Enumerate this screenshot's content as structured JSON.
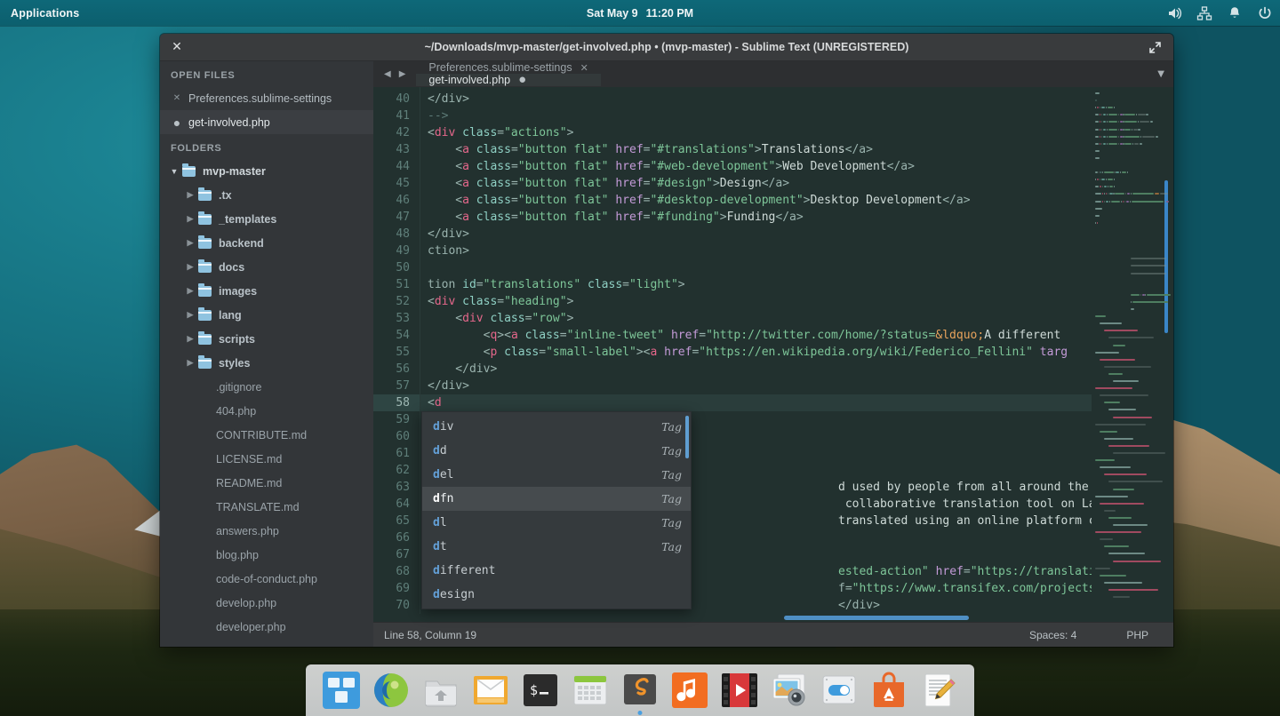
{
  "panel": {
    "applications_label": "Applications",
    "clock_day": "Sat May  9",
    "clock_time": "11:20 PM",
    "tray": [
      "volume-icon",
      "network-icon",
      "notification-icon",
      "power-icon"
    ]
  },
  "window": {
    "title": "~/Downloads/mvp-master/get-involved.php • (mvp-master) - Sublime Text (UNREGISTERED)",
    "close_glyph": "✕",
    "maximize_glyph": "⤢"
  },
  "sidebar": {
    "open_files_title": "OPEN FILES",
    "open_files": [
      {
        "name": "Preferences.sublime-settings",
        "icon": "close-icon",
        "active": false
      },
      {
        "name": "get-involved.php",
        "icon": "unsaved-dot-icon",
        "active": true
      }
    ],
    "folders_title": "FOLDERS",
    "root": "mvp-master",
    "folders": [
      ".tx",
      "_templates",
      "backend",
      "docs",
      "images",
      "lang",
      "scripts",
      "styles"
    ],
    "files": [
      ".gitignore",
      "404.php",
      "CONTRIBUTE.md",
      "LICENSE.md",
      "README.md",
      "TRANSLATE.md",
      "answers.php",
      "blog.php",
      "code-of-conduct.php",
      "develop.php",
      "developer.php"
    ]
  },
  "tabs": {
    "nav_prev": "◀",
    "nav_next": "▶",
    "menu_glyph": "▼",
    "items": [
      {
        "label": "Preferences.sublime-settings",
        "active": false,
        "badge": "✕"
      },
      {
        "label": "get-involved.php",
        "active": true,
        "badge": "●"
      }
    ]
  },
  "editor": {
    "first_line": 40,
    "current_line": 58,
    "lines": [
      {
        "n": 40,
        "tokens": [
          {
            "t": "</div>",
            "c": "c-punct"
          }
        ]
      },
      {
        "n": 41,
        "tokens": [
          {
            "t": "-->",
            "c": "c-comm"
          }
        ]
      },
      {
        "n": 42,
        "tokens": [
          {
            "t": "<",
            "c": "c-punct"
          },
          {
            "t": "div",
            "c": "c-tag"
          },
          {
            "t": " ",
            "c": "c-text"
          },
          {
            "t": "class",
            "c": "c-op"
          },
          {
            "t": "=",
            "c": "c-punct"
          },
          {
            "t": "\"actions\"",
            "c": "c-str"
          },
          {
            "t": ">",
            "c": "c-punct"
          }
        ]
      },
      {
        "n": 43,
        "tokens": [
          {
            "t": "    <",
            "c": "c-punct"
          },
          {
            "t": "a",
            "c": "c-tag"
          },
          {
            "t": " ",
            "c": "c-text"
          },
          {
            "t": "class",
            "c": "c-op"
          },
          {
            "t": "=",
            "c": "c-punct"
          },
          {
            "t": "\"button flat\"",
            "c": "c-str"
          },
          {
            "t": " ",
            "c": "c-text"
          },
          {
            "t": "href",
            "c": "c-attr"
          },
          {
            "t": "=",
            "c": "c-punct"
          },
          {
            "t": "\"#translations\"",
            "c": "c-str"
          },
          {
            "t": ">",
            "c": "c-punct"
          },
          {
            "t": "Translations",
            "c": "c-text"
          },
          {
            "t": "</a>",
            "c": "c-punct"
          }
        ]
      },
      {
        "n": 44,
        "tokens": [
          {
            "t": "    <",
            "c": "c-punct"
          },
          {
            "t": "a",
            "c": "c-tag"
          },
          {
            "t": " ",
            "c": "c-text"
          },
          {
            "t": "class",
            "c": "c-op"
          },
          {
            "t": "=",
            "c": "c-punct"
          },
          {
            "t": "\"button flat\"",
            "c": "c-str"
          },
          {
            "t": " ",
            "c": "c-text"
          },
          {
            "t": "href",
            "c": "c-attr"
          },
          {
            "t": "=",
            "c": "c-punct"
          },
          {
            "t": "\"#web-development\"",
            "c": "c-str"
          },
          {
            "t": ">",
            "c": "c-punct"
          },
          {
            "t": "Web Development",
            "c": "c-text"
          },
          {
            "t": "</a>",
            "c": "c-punct"
          }
        ]
      },
      {
        "n": 45,
        "tokens": [
          {
            "t": "    <",
            "c": "c-punct"
          },
          {
            "t": "a",
            "c": "c-tag"
          },
          {
            "t": " ",
            "c": "c-text"
          },
          {
            "t": "class",
            "c": "c-op"
          },
          {
            "t": "=",
            "c": "c-punct"
          },
          {
            "t": "\"button flat\"",
            "c": "c-str"
          },
          {
            "t": " ",
            "c": "c-text"
          },
          {
            "t": "href",
            "c": "c-attr"
          },
          {
            "t": "=",
            "c": "c-punct"
          },
          {
            "t": "\"#design\"",
            "c": "c-str"
          },
          {
            "t": ">",
            "c": "c-punct"
          },
          {
            "t": "Design",
            "c": "c-text"
          },
          {
            "t": "</a>",
            "c": "c-punct"
          }
        ]
      },
      {
        "n": 46,
        "tokens": [
          {
            "t": "    <",
            "c": "c-punct"
          },
          {
            "t": "a",
            "c": "c-tag"
          },
          {
            "t": " ",
            "c": "c-text"
          },
          {
            "t": "class",
            "c": "c-op"
          },
          {
            "t": "=",
            "c": "c-punct"
          },
          {
            "t": "\"button flat\"",
            "c": "c-str"
          },
          {
            "t": " ",
            "c": "c-text"
          },
          {
            "t": "href",
            "c": "c-attr"
          },
          {
            "t": "=",
            "c": "c-punct"
          },
          {
            "t": "\"#desktop-development\"",
            "c": "c-str"
          },
          {
            "t": ">",
            "c": "c-punct"
          },
          {
            "t": "Desktop Development",
            "c": "c-text"
          },
          {
            "t": "</a>",
            "c": "c-punct"
          }
        ]
      },
      {
        "n": 47,
        "tokens": [
          {
            "t": "    <",
            "c": "c-punct"
          },
          {
            "t": "a",
            "c": "c-tag"
          },
          {
            "t": " ",
            "c": "c-text"
          },
          {
            "t": "class",
            "c": "c-op"
          },
          {
            "t": "=",
            "c": "c-punct"
          },
          {
            "t": "\"button flat\"",
            "c": "c-str"
          },
          {
            "t": " ",
            "c": "c-text"
          },
          {
            "t": "href",
            "c": "c-attr"
          },
          {
            "t": "=",
            "c": "c-punct"
          },
          {
            "t": "\"#funding\"",
            "c": "c-str"
          },
          {
            "t": ">",
            "c": "c-punct"
          },
          {
            "t": "Funding",
            "c": "c-text"
          },
          {
            "t": "</a>",
            "c": "c-punct"
          }
        ]
      },
      {
        "n": 48,
        "tokens": [
          {
            "t": "</div>",
            "c": "c-punct"
          }
        ]
      },
      {
        "n": 49,
        "tokens": [
          {
            "t": "ction>",
            "c": "c-punct"
          }
        ]
      },
      {
        "n": 50,
        "tokens": []
      },
      {
        "n": 51,
        "tokens": [
          {
            "t": "tion",
            "c": "c-punct"
          },
          {
            "t": " ",
            "c": "c-text"
          },
          {
            "t": "id",
            "c": "c-op"
          },
          {
            "t": "=",
            "c": "c-punct"
          },
          {
            "t": "\"translations\"",
            "c": "c-str"
          },
          {
            "t": " ",
            "c": "c-text"
          },
          {
            "t": "class",
            "c": "c-op"
          },
          {
            "t": "=",
            "c": "c-punct"
          },
          {
            "t": "\"light\"",
            "c": "c-str"
          },
          {
            "t": ">",
            "c": "c-punct"
          }
        ]
      },
      {
        "n": 52,
        "tokens": [
          {
            "t": "<",
            "c": "c-punct"
          },
          {
            "t": "div",
            "c": "c-tag"
          },
          {
            "t": " ",
            "c": "c-text"
          },
          {
            "t": "class",
            "c": "c-op"
          },
          {
            "t": "=",
            "c": "c-punct"
          },
          {
            "t": "\"heading\"",
            "c": "c-str"
          },
          {
            "t": ">",
            "c": "c-punct"
          }
        ]
      },
      {
        "n": 53,
        "tokens": [
          {
            "t": "    <",
            "c": "c-punct"
          },
          {
            "t": "div",
            "c": "c-tag"
          },
          {
            "t": " ",
            "c": "c-text"
          },
          {
            "t": "class",
            "c": "c-op"
          },
          {
            "t": "=",
            "c": "c-punct"
          },
          {
            "t": "\"row\"",
            "c": "c-str"
          },
          {
            "t": ">",
            "c": "c-punct"
          }
        ]
      },
      {
        "n": 54,
        "tokens": [
          {
            "t": "        <",
            "c": "c-punct"
          },
          {
            "t": "q",
            "c": "c-tag"
          },
          {
            "t": "><",
            "c": "c-punct"
          },
          {
            "t": "a",
            "c": "c-tag"
          },
          {
            "t": " ",
            "c": "c-text"
          },
          {
            "t": "class",
            "c": "c-op"
          },
          {
            "t": "=",
            "c": "c-punct"
          },
          {
            "t": "\"inline-tweet\"",
            "c": "c-str"
          },
          {
            "t": " ",
            "c": "c-text"
          },
          {
            "t": "href",
            "c": "c-attr"
          },
          {
            "t": "=",
            "c": "c-punct"
          },
          {
            "t": "\"http://twitter.com/home/?status=",
            "c": "c-str"
          },
          {
            "t": "&ldquo;",
            "c": "c-ent"
          },
          {
            "t": "A different ",
            "c": "c-text"
          }
        ]
      },
      {
        "n": 55,
        "tokens": [
          {
            "t": "        <",
            "c": "c-punct"
          },
          {
            "t": "p",
            "c": "c-tag"
          },
          {
            "t": " ",
            "c": "c-text"
          },
          {
            "t": "class",
            "c": "c-op"
          },
          {
            "t": "=",
            "c": "c-punct"
          },
          {
            "t": "\"small-label\"",
            "c": "c-str"
          },
          {
            "t": "><",
            "c": "c-punct"
          },
          {
            "t": "a",
            "c": "c-tag"
          },
          {
            "t": " ",
            "c": "c-text"
          },
          {
            "t": "href",
            "c": "c-attr"
          },
          {
            "t": "=",
            "c": "c-punct"
          },
          {
            "t": "\"https://en.wikipedia.org/wiki/Federico_Fellini\"",
            "c": "c-str"
          },
          {
            "t": " ",
            "c": "c-text"
          },
          {
            "t": "targ",
            "c": "c-attr"
          }
        ]
      },
      {
        "n": 56,
        "tokens": [
          {
            "t": "    </div>",
            "c": "c-punct"
          }
        ]
      },
      {
        "n": 57,
        "tokens": [
          {
            "t": "</div>",
            "c": "c-punct"
          }
        ]
      },
      {
        "n": 58,
        "tokens": [
          {
            "t": "<",
            "c": "c-punct"
          },
          {
            "t": "d",
            "c": "c-tag"
          }
        ]
      },
      {
        "n": 59,
        "tokens": []
      },
      {
        "n": 60,
        "tokens": []
      },
      {
        "n": 61,
        "tokens": []
      },
      {
        "n": 62,
        "tokens": []
      },
      {
        "n": 63,
        "tokens": [
          {
            "t": "d used by people from all around the World; help us ma",
            "c": "c-text",
            "indent": 470
          }
        ]
      },
      {
        "n": 64,
        "tokens": [
          {
            "t": " collaborative translation tool on Launchpad called Ro",
            "c": "c-text",
            "indent": 470
          }
        ]
      },
      {
        "n": 65,
        "tokens": [
          {
            "t": "translated using an online platform called Transifex. ",
            "c": "c-text",
            "indent": 470
          }
        ]
      },
      {
        "n": 66,
        "tokens": []
      },
      {
        "n": 67,
        "tokens": []
      },
      {
        "n": 68,
        "tokens": [
          {
            "t": "ested-action\"",
            "c": "c-str",
            "indent": 470
          },
          {
            "t": " ",
            "c": "c-text"
          },
          {
            "t": "href",
            "c": "c-attr"
          },
          {
            "t": "=",
            "c": "c-punct"
          },
          {
            "t": "\"https://translations.launchpad.net,",
            "c": "c-str"
          }
        ]
      },
      {
        "n": 69,
        "tokens": [
          {
            "t": "f=",
            "c": "c-punct",
            "indent": 470
          },
          {
            "t": "\"https://www.transifex.com/projects/p/elementary-mvp,",
            "c": "c-str"
          }
        ]
      },
      {
        "n": 70,
        "tokens": [
          {
            "t": "</div>",
            "c": "c-punct",
            "indent": 470
          }
        ]
      }
    ]
  },
  "autocomplete": {
    "items": [
      {
        "prefix": "d",
        "rest": "iv",
        "kind": "Tag",
        "selected": false
      },
      {
        "prefix": "d",
        "rest": "d",
        "kind": "Tag",
        "selected": false
      },
      {
        "prefix": "d",
        "rest": "el",
        "kind": "Tag",
        "selected": false
      },
      {
        "prefix": "d",
        "rest": "fn",
        "kind": "Tag",
        "selected": true
      },
      {
        "prefix": "d",
        "rest": "l",
        "kind": "Tag",
        "selected": false
      },
      {
        "prefix": "d",
        "rest": "t",
        "kind": "Tag",
        "selected": false
      },
      {
        "prefix": "d",
        "rest": "ifferent",
        "kind": "",
        "selected": false
      },
      {
        "prefix": "d",
        "rest": "esign",
        "kind": "",
        "selected": false
      }
    ]
  },
  "statusbar": {
    "position": "Line 58, Column 19",
    "indentation": "Spaces: 4",
    "syntax": "PHP"
  },
  "dock": {
    "items": [
      "applications-menu-icon",
      "web-browser-icon",
      "files-icon",
      "mail-icon",
      "terminal-icon",
      "calendar-icon",
      "sublime-text-icon",
      "music-icon",
      "video-icon",
      "photos-icon",
      "system-settings-icon",
      "app-center-icon",
      "text-editor-icon"
    ],
    "running": [
      "sublime-text-icon"
    ]
  },
  "colors": {
    "panel_bg": "#0c5f6e",
    "window_chrome": "#393b3d",
    "sidebar_bg": "#333639",
    "editor_bg": "#22312f",
    "accent_blue": "#4f8fc4",
    "tag_red": "#e5678b",
    "string_green": "#7ec699"
  }
}
